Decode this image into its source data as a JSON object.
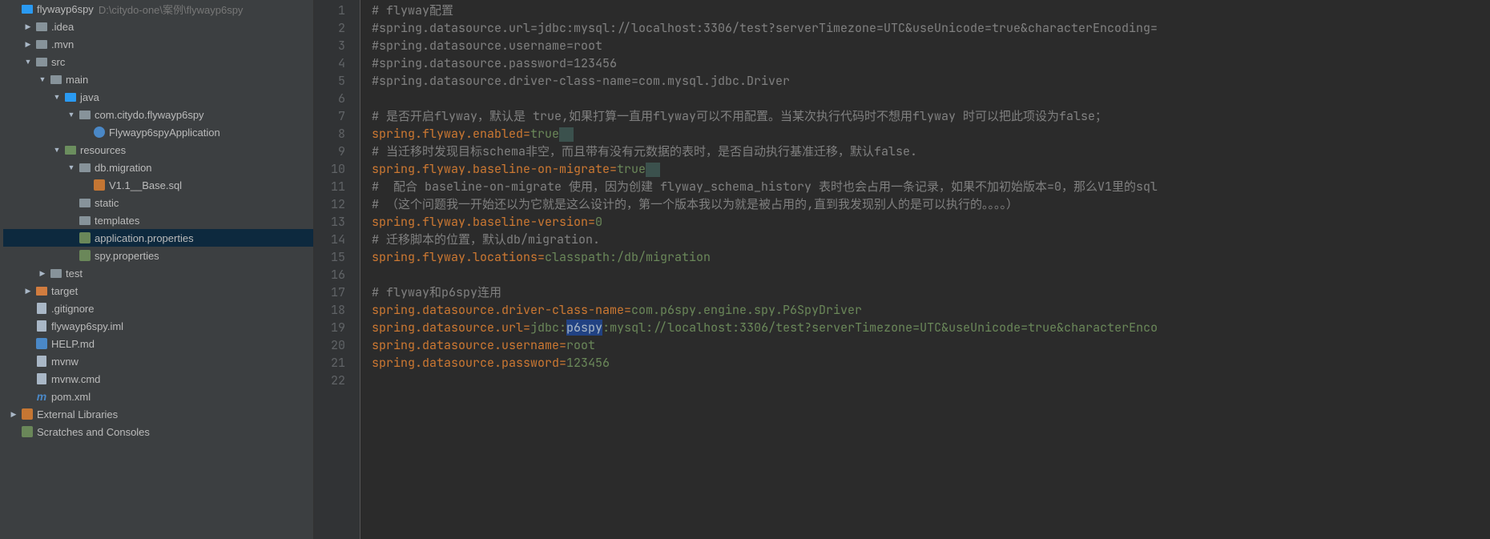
{
  "project": {
    "name": "flywayp6spy",
    "path": "D:\\citydo-one\\案例\\flywayp6spy"
  },
  "tree": [
    {
      "indent": 0,
      "arrow": "blank",
      "icon": "folder-blue",
      "label": "flywayp6spy",
      "path": "D:\\citydo-one\\案例\\flywayp6spy",
      "selected": false
    },
    {
      "indent": 1,
      "arrow": "right",
      "icon": "folder-gray",
      "label": ".idea"
    },
    {
      "indent": 1,
      "arrow": "right",
      "icon": "folder-gray",
      "label": ".mvn"
    },
    {
      "indent": 1,
      "arrow": "down",
      "icon": "folder-gray",
      "label": "src"
    },
    {
      "indent": 2,
      "arrow": "down",
      "icon": "folder-gray",
      "label": "main"
    },
    {
      "indent": 3,
      "arrow": "down",
      "icon": "folder-blue",
      "label": "java"
    },
    {
      "indent": 4,
      "arrow": "down",
      "icon": "folder-pkg",
      "label": "com.citydo.flywayp6spy"
    },
    {
      "indent": 5,
      "arrow": "blank",
      "icon": "class-icon",
      "label": "Flywayp6spyApplication"
    },
    {
      "indent": 3,
      "arrow": "down",
      "icon": "folder-green",
      "label": "resources"
    },
    {
      "indent": 4,
      "arrow": "down",
      "icon": "folder-pkg",
      "label": "db.migration"
    },
    {
      "indent": 5,
      "arrow": "blank",
      "icon": "sql-icon",
      "label": "V1.1__Base.sql"
    },
    {
      "indent": 4,
      "arrow": "blank",
      "icon": "folder-pkg",
      "label": "static"
    },
    {
      "indent": 4,
      "arrow": "blank",
      "icon": "folder-pkg",
      "label": "templates"
    },
    {
      "indent": 4,
      "arrow": "blank",
      "icon": "props-icon",
      "label": "application.properties",
      "selected": true
    },
    {
      "indent": 4,
      "arrow": "blank",
      "icon": "props-icon",
      "label": "spy.properties"
    },
    {
      "indent": 2,
      "arrow": "right",
      "icon": "folder-gray",
      "label": "test"
    },
    {
      "indent": 1,
      "arrow": "right",
      "icon": "folder-orange",
      "label": "target"
    },
    {
      "indent": 1,
      "arrow": "blank",
      "icon": "file-icon",
      "label": ".gitignore"
    },
    {
      "indent": 1,
      "arrow": "blank",
      "icon": "file-icon",
      "label": "flywayp6spy.iml"
    },
    {
      "indent": 1,
      "arrow": "blank",
      "icon": "md-icon",
      "label": "HELP.md"
    },
    {
      "indent": 1,
      "arrow": "blank",
      "icon": "file-icon",
      "label": "mvnw"
    },
    {
      "indent": 1,
      "arrow": "blank",
      "icon": "file-icon",
      "label": "mvnw.cmd"
    },
    {
      "indent": 1,
      "arrow": "blank",
      "icon": "maven-icon",
      "label": "pom.xml"
    },
    {
      "indent": 0,
      "arrow": "right",
      "icon": "lib-icon",
      "label": "External Libraries"
    },
    {
      "indent": 0,
      "arrow": "blank",
      "icon": "scratch-icon",
      "label": "Scratches and Consoles"
    }
  ],
  "editor": {
    "lines": [
      {
        "n": 1,
        "tokens": [
          {
            "t": "comment",
            "v": "# flyway配置"
          }
        ]
      },
      {
        "n": 2,
        "tokens": [
          {
            "t": "comment",
            "v": "#spring.datasource.url=jdbc:mysql://localhost:3306/test?serverTimezone=UTC&useUnicode=true&characterEncoding="
          }
        ]
      },
      {
        "n": 3,
        "tokens": [
          {
            "t": "comment",
            "v": "#spring.datasource.username=root"
          }
        ]
      },
      {
        "n": 4,
        "tokens": [
          {
            "t": "comment",
            "v": "#spring.datasource.password=123456"
          }
        ]
      },
      {
        "n": 5,
        "tokens": [
          {
            "t": "comment",
            "v": "#spring.datasource.driver-class-name=com.mysql.jdbc.Driver"
          }
        ]
      },
      {
        "n": 6,
        "tokens": []
      },
      {
        "n": 7,
        "tokens": [
          {
            "t": "comment",
            "v": "# 是否开启flyway，默认是 true,如果打算一直用flyway可以不用配置。当某次执行代码时不想用flyway 时可以把此项设为false；"
          }
        ]
      },
      {
        "n": 8,
        "tokens": [
          {
            "t": "key",
            "v": "spring.flyway.enabled"
          },
          {
            "t": "eq",
            "v": "="
          },
          {
            "t": "value",
            "v": "true"
          },
          {
            "t": "ws",
            "v": "  "
          }
        ]
      },
      {
        "n": 9,
        "tokens": [
          {
            "t": "comment",
            "v": "# 当迁移时发现目标schema非空，而且带有没有元数据的表时，是否自动执行基准迁移，默认false."
          }
        ]
      },
      {
        "n": 10,
        "tokens": [
          {
            "t": "key",
            "v": "spring.flyway.baseline-on-migrate"
          },
          {
            "t": "eq",
            "v": "="
          },
          {
            "t": "value",
            "v": "true"
          },
          {
            "t": "ws",
            "v": "  "
          }
        ]
      },
      {
        "n": 11,
        "tokens": [
          {
            "t": "comment",
            "v": "#  配合 baseline-on-migrate 使用，因为创建 flyway_schema_history 表时也会占用一条记录，如果不加初始版本=0，那么V1里的sql"
          }
        ]
      },
      {
        "n": 12,
        "tokens": [
          {
            "t": "comment",
            "v": "# （这个问题我一开始还以为它就是这么设计的，第一个版本我以为就是被占用的,直到我发现别人的是可以执行的。。。。）"
          }
        ]
      },
      {
        "n": 13,
        "tokens": [
          {
            "t": "key",
            "v": "spring.flyway.baseline-version"
          },
          {
            "t": "eq",
            "v": "="
          },
          {
            "t": "value",
            "v": "0"
          }
        ]
      },
      {
        "n": 14,
        "tokens": [
          {
            "t": "comment",
            "v": "# 迁移脚本的位置，默认db/migration."
          }
        ]
      },
      {
        "n": 15,
        "tokens": [
          {
            "t": "key",
            "v": "spring.flyway.locations"
          },
          {
            "t": "eq",
            "v": "="
          },
          {
            "t": "value",
            "v": "classpath:/db/migration"
          }
        ]
      },
      {
        "n": 16,
        "tokens": []
      },
      {
        "n": 17,
        "tokens": [
          {
            "t": "comment",
            "v": "# flyway和p6spy连用"
          }
        ]
      },
      {
        "n": 18,
        "tokens": [
          {
            "t": "key",
            "v": "spring.datasource.driver-class-name"
          },
          {
            "t": "eq",
            "v": "="
          },
          {
            "t": "value",
            "v": "com.p6spy.engine.spy.P6SpyDriver"
          }
        ]
      },
      {
        "n": 19,
        "tokens": [
          {
            "t": "key",
            "v": "spring.datasource.url"
          },
          {
            "t": "eq",
            "v": "="
          },
          {
            "t": "value",
            "v": "jdbc:"
          },
          {
            "t": "selection",
            "v": "p6spy"
          },
          {
            "t": "value",
            "v": ":mysql://localhost:3306/test?serverTimezone=UTC&useUnicode=true&characterEnco"
          }
        ]
      },
      {
        "n": 20,
        "tokens": [
          {
            "t": "key",
            "v": "spring.datasource.username"
          },
          {
            "t": "eq",
            "v": "="
          },
          {
            "t": "value",
            "v": "root"
          }
        ]
      },
      {
        "n": 21,
        "tokens": [
          {
            "t": "key",
            "v": "spring.datasource.password"
          },
          {
            "t": "eq",
            "v": "="
          },
          {
            "t": "value",
            "v": "123456"
          }
        ]
      },
      {
        "n": 22,
        "tokens": []
      }
    ]
  }
}
